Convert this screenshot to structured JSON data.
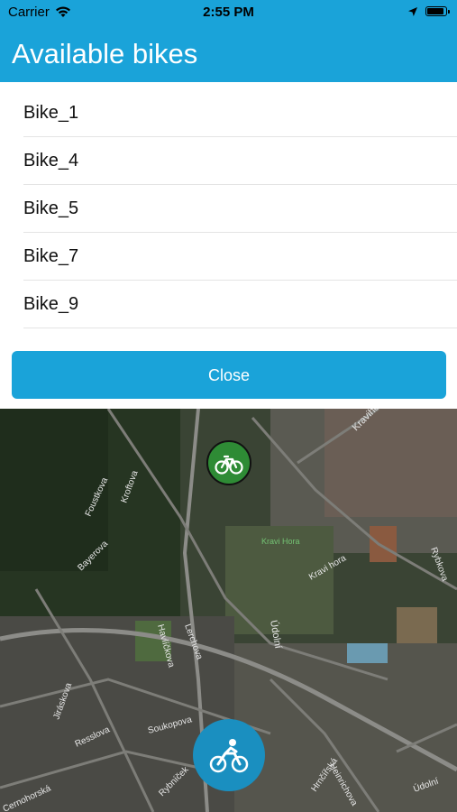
{
  "status_bar": {
    "carrier": "Carrier",
    "time": "2:55 PM",
    "battery_level": 0.95,
    "icons": [
      "wifi-icon",
      "location-arrow-icon",
      "battery-icon"
    ]
  },
  "header": {
    "title": "Available bikes"
  },
  "bikes": [
    "Bike_1",
    "Bike_4",
    "Bike_5",
    "Bike_7",
    "Bike_9"
  ],
  "close_label": "Close",
  "map": {
    "labels": [
      "Kravihorská",
      "Kravi Hora",
      "Údolní",
      "Kravi hora",
      "Foustkova",
      "Kroftova",
      "Bayerova",
      "Rybkova",
      "Lerchova",
      "Havlíčkova",
      "Soukopova",
      "Hrnčířská",
      "Resslova",
      "Jiráskova",
      "Cernohorská",
      "Rybníček",
      "Údolní",
      "Heinrichova"
    ],
    "marker_icon": "bicycle-icon",
    "fab_icon": "cyclist-icon"
  },
  "colors": {
    "brand": "#1aa3d9",
    "marker_green": "#2e8b35",
    "fab_blue": "#1a8fc0"
  }
}
